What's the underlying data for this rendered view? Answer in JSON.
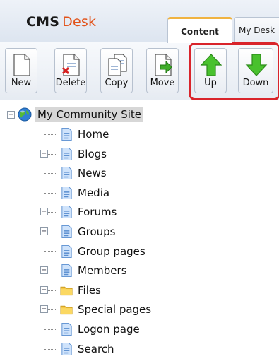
{
  "header": {
    "logo_cms": "CMS",
    "logo_desk": "Desk",
    "tabs": [
      {
        "label": "Content",
        "active": true
      },
      {
        "label": "My Desk",
        "active": false
      }
    ]
  },
  "toolbar": {
    "buttons": [
      {
        "label": "New",
        "icon": "new-page-icon"
      },
      {
        "label": "Delete",
        "icon": "delete-page-icon"
      },
      {
        "label": "Copy",
        "icon": "copy-page-icon"
      },
      {
        "label": "Move",
        "icon": "move-page-icon"
      },
      {
        "label": "Up",
        "icon": "arrow-up-icon"
      },
      {
        "label": "Down",
        "icon": "arrow-down-icon"
      }
    ],
    "highlight_color": "#d9242b"
  },
  "tree": {
    "root": {
      "label": "My Community Site",
      "icon": "globe-icon",
      "expanded": true
    },
    "items": [
      {
        "label": "Home",
        "icon": "page-icon",
        "expandable": false
      },
      {
        "label": "Blogs",
        "icon": "page-icon",
        "expandable": true
      },
      {
        "label": "News",
        "icon": "page-icon",
        "expandable": false
      },
      {
        "label": "Media",
        "icon": "page-icon",
        "expandable": false
      },
      {
        "label": "Forums",
        "icon": "page-icon",
        "expandable": true
      },
      {
        "label": "Groups",
        "icon": "page-icon",
        "expandable": true
      },
      {
        "label": "Group pages",
        "icon": "page-icon",
        "expandable": false
      },
      {
        "label": "Members",
        "icon": "page-icon",
        "expandable": true
      },
      {
        "label": "Files",
        "icon": "folder-icon",
        "expandable": true
      },
      {
        "label": "Special pages",
        "icon": "folder-icon",
        "expandable": true
      },
      {
        "label": "Logon page",
        "icon": "page-icon",
        "expandable": false
      },
      {
        "label": "Search",
        "icon": "page-icon",
        "expandable": false
      }
    ]
  }
}
